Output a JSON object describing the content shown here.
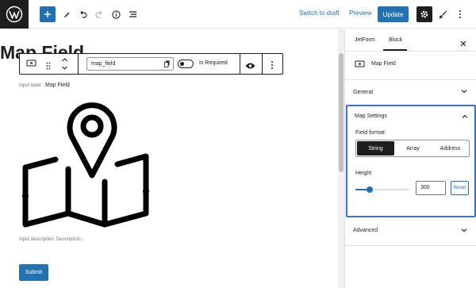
{
  "topbar": {
    "switch_to_draft": "Switch to draft",
    "preview": "Preview",
    "update": "Update"
  },
  "editor": {
    "page_title": "Map Field",
    "block_toolbar": {
      "field_name_value": "map_field",
      "required_label": "Is Required"
    },
    "input_label_caption": "input label:",
    "input_label_value": "Map Field",
    "input_description": "input description:  Description...",
    "submit_label": "Submit"
  },
  "sidebar": {
    "tabs": [
      {
        "label": "JetForm"
      },
      {
        "label": "Block",
        "active": true
      }
    ],
    "block_name": "Map Field",
    "panels": {
      "general": "General",
      "map_settings": {
        "title": "Map Settings",
        "field_format_label": "Field format",
        "field_format_options": [
          "String",
          "Array",
          "Address"
        ],
        "field_format_selected": "String",
        "height_label": "Height",
        "height_value": "300",
        "height_slider_fraction": 0.27,
        "reset_label": "Reset"
      },
      "advanced": "Advanced"
    }
  },
  "colors": {
    "accent": "#2271b1",
    "focus_border": "#3b73c6",
    "dark": "#1e1e1e"
  }
}
